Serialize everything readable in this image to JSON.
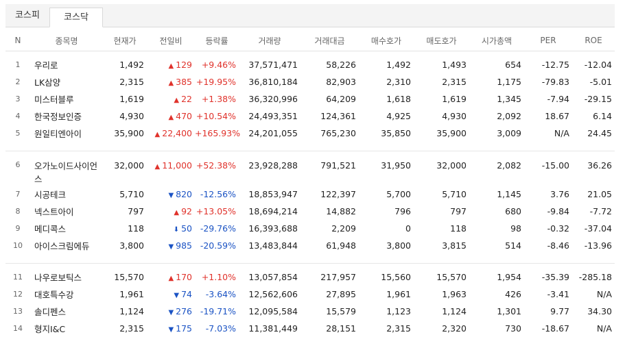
{
  "tabs": [
    "코스피",
    "코스닥"
  ],
  "active_tab": "코스닥",
  "columns": [
    "N",
    "종목명",
    "현재가",
    "전일비",
    "등락률",
    "거래량",
    "거래대금",
    "매수호가",
    "매도호가",
    "시가총액",
    "PER",
    "ROE"
  ],
  "colors": {
    "up": "#e0322b",
    "down": "#1b53c4"
  },
  "rows": [
    {
      "n": "1",
      "name": "우리로",
      "price": "1,492",
      "dir": "up",
      "icon": "triangle-up",
      "change": "129",
      "rate": "+9.46%",
      "volume": "37,571,471",
      "value": "58,226",
      "bid": "1,492",
      "ask": "1,493",
      "mcap": "654",
      "per": "-12.75",
      "roe": "-12.04"
    },
    {
      "n": "2",
      "name": "LK삼양",
      "price": "2,315",
      "dir": "up",
      "icon": "triangle-up",
      "change": "385",
      "rate": "+19.95%",
      "volume": "36,810,184",
      "value": "82,903",
      "bid": "2,310",
      "ask": "2,315",
      "mcap": "1,175",
      "per": "-79.83",
      "roe": "-5.01"
    },
    {
      "n": "3",
      "name": "미스터블루",
      "price": "1,619",
      "dir": "up",
      "icon": "triangle-up",
      "change": "22",
      "rate": "+1.38%",
      "volume": "36,320,996",
      "value": "64,209",
      "bid": "1,618",
      "ask": "1,619",
      "mcap": "1,345",
      "per": "-7.94",
      "roe": "-29.15"
    },
    {
      "n": "4",
      "name": "한국정보인증",
      "price": "4,930",
      "dir": "up",
      "icon": "triangle-up",
      "change": "470",
      "rate": "+10.54%",
      "volume": "24,493,351",
      "value": "124,361",
      "bid": "4,925",
      "ask": "4,930",
      "mcap": "2,092",
      "per": "18.67",
      "roe": "6.14"
    },
    {
      "n": "5",
      "name": "원일티엔아이",
      "price": "35,900",
      "dir": "up",
      "icon": "triangle-up",
      "change": "22,400",
      "rate": "+165.93%",
      "volume": "24,201,055",
      "value": "765,230",
      "bid": "35,850",
      "ask": "35,900",
      "mcap": "3,009",
      "per": "N/A",
      "roe": "24.45"
    },
    {
      "n": "6",
      "name": "오가노이드사이언스",
      "price": "32,000",
      "dir": "up",
      "icon": "triangle-up",
      "change": "11,000",
      "rate": "+52.38%",
      "volume": "23,928,288",
      "value": "791,521",
      "bid": "31,950",
      "ask": "32,000",
      "mcap": "2,082",
      "per": "-15.00",
      "roe": "36.26"
    },
    {
      "n": "7",
      "name": "시공테크",
      "price": "5,710",
      "dir": "down",
      "icon": "triangle-down",
      "change": "820",
      "rate": "-12.56%",
      "volume": "18,853,947",
      "value": "122,397",
      "bid": "5,700",
      "ask": "5,710",
      "mcap": "1,145",
      "per": "3.76",
      "roe": "21.05"
    },
    {
      "n": "8",
      "name": "넥스트아이",
      "price": "797",
      "dir": "up",
      "icon": "triangle-up",
      "change": "92",
      "rate": "+13.05%",
      "volume": "18,694,214",
      "value": "14,882",
      "bid": "796",
      "ask": "797",
      "mcap": "680",
      "per": "-9.84",
      "roe": "-7.72"
    },
    {
      "n": "9",
      "name": "메디콕스",
      "price": "118",
      "dir": "down",
      "icon": "arrow-down",
      "change": "50",
      "rate": "-29.76%",
      "volume": "16,393,688",
      "value": "2,209",
      "bid": "0",
      "ask": "118",
      "mcap": "98",
      "per": "-0.32",
      "roe": "-37.04"
    },
    {
      "n": "10",
      "name": "아이스크림에듀",
      "price": "3,800",
      "dir": "down",
      "icon": "triangle-down",
      "change": "985",
      "rate": "-20.59%",
      "volume": "13,483,844",
      "value": "61,948",
      "bid": "3,800",
      "ask": "3,815",
      "mcap": "514",
      "per": "-8.46",
      "roe": "-13.96"
    },
    {
      "n": "11",
      "name": "나우로보틱스",
      "price": "15,570",
      "dir": "up",
      "icon": "triangle-up",
      "change": "170",
      "rate": "+1.10%",
      "volume": "13,057,854",
      "value": "217,957",
      "bid": "15,560",
      "ask": "15,570",
      "mcap": "1,954",
      "per": "-35.39",
      "roe": "-285.18"
    },
    {
      "n": "12",
      "name": "대호특수강",
      "price": "1,961",
      "dir": "down",
      "icon": "triangle-down",
      "change": "74",
      "rate": "-3.64%",
      "volume": "12,562,606",
      "value": "27,895",
      "bid": "1,961",
      "ask": "1,963",
      "mcap": "426",
      "per": "-3.41",
      "roe": "N/A"
    },
    {
      "n": "13",
      "name": "솔디펜스",
      "price": "1,124",
      "dir": "down",
      "icon": "triangle-down",
      "change": "276",
      "rate": "-19.71%",
      "volume": "12,095,584",
      "value": "15,579",
      "bid": "1,123",
      "ask": "1,124",
      "mcap": "1,301",
      "per": "9.77",
      "roe": "34.30"
    },
    {
      "n": "14",
      "name": "형지I&C",
      "price": "2,315",
      "dir": "down",
      "icon": "triangle-down",
      "change": "175",
      "rate": "-7.03%",
      "volume": "11,381,449",
      "value": "28,151",
      "bid": "2,315",
      "ask": "2,320",
      "mcap": "730",
      "per": "-18.67",
      "roe": "N/A"
    }
  ]
}
